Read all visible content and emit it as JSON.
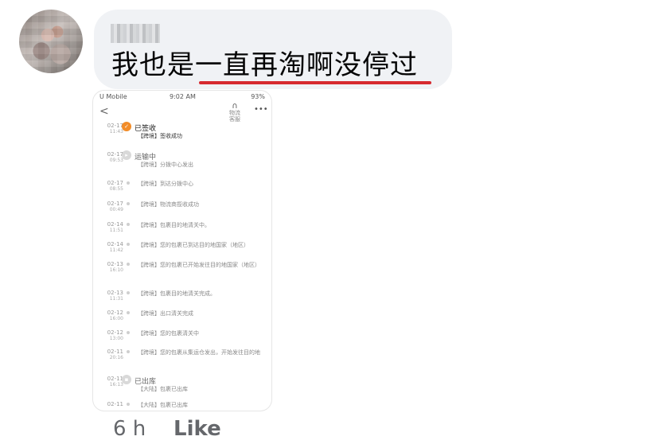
{
  "comment": {
    "text": "我也是一直再淘啊没停过",
    "time": "6 h",
    "like_label": "Like"
  },
  "screenshot": {
    "status_bar": {
      "carrier": "U Mobile",
      "time": "9:02 AM",
      "battery": "93%"
    },
    "nav": {
      "back_icon": "chevron-left-icon",
      "service_label": "物流客服",
      "more_label": "•••"
    },
    "events": [
      {
        "date": "02-17",
        "time": "11:43",
        "status": "已签收",
        "desc": "【跨境】签收成功",
        "kind": "ok"
      },
      {
        "date": "02-17",
        "time": "09:53",
        "status": "运输中",
        "desc": "【跨境】分拨中心发出",
        "kind": "status"
      },
      {
        "date": "02-17",
        "time": "08:55",
        "status": "",
        "desc": "【跨境】到达分拨中心",
        "kind": "dot"
      },
      {
        "date": "02-17",
        "time": "00:49",
        "status": "",
        "desc": "【跨境】物流商揽收成功",
        "kind": "dot"
      },
      {
        "date": "02-14",
        "time": "11:51",
        "status": "",
        "desc": "【跨境】包裹目的地清关中。",
        "kind": "dot"
      },
      {
        "date": "02-14",
        "time": "11:42",
        "status": "",
        "desc": "【跨境】您的包裹已到达目的地国家（地区）",
        "kind": "dot"
      },
      {
        "date": "02-13",
        "time": "16:10",
        "status": "",
        "desc": "【跨境】您的包裹已开始发往目的地国家（地区）",
        "kind": "dot"
      },
      {
        "date": "02-13",
        "time": "11:31",
        "status": "",
        "desc": "【跨境】包裹目的地清关完成。",
        "kind": "dot"
      },
      {
        "date": "02-12",
        "time": "16:00",
        "status": "",
        "desc": "【跨境】出口清关完成",
        "kind": "dot"
      },
      {
        "date": "02-12",
        "time": "13:00",
        "status": "",
        "desc": "【跨境】您的包裹清关中",
        "kind": "dot"
      },
      {
        "date": "02-11",
        "time": "20:16",
        "status": "",
        "desc": "【跨境】您的包裹从集运仓发出，开始发往目的地",
        "kind": "dot"
      },
      {
        "date": "02-11",
        "time": "16:13",
        "status": "已出库",
        "desc": "【大陆】包裹已出库",
        "kind": "status"
      },
      {
        "date": "02-11",
        "time": "",
        "status": "",
        "desc": "【大陆】包裹已出库",
        "kind": "dot"
      }
    ]
  },
  "colors": {
    "bubble": "#f0f2f5",
    "underline": "#d62a2f",
    "accent": "#f28c28",
    "meta": "#65676b"
  }
}
